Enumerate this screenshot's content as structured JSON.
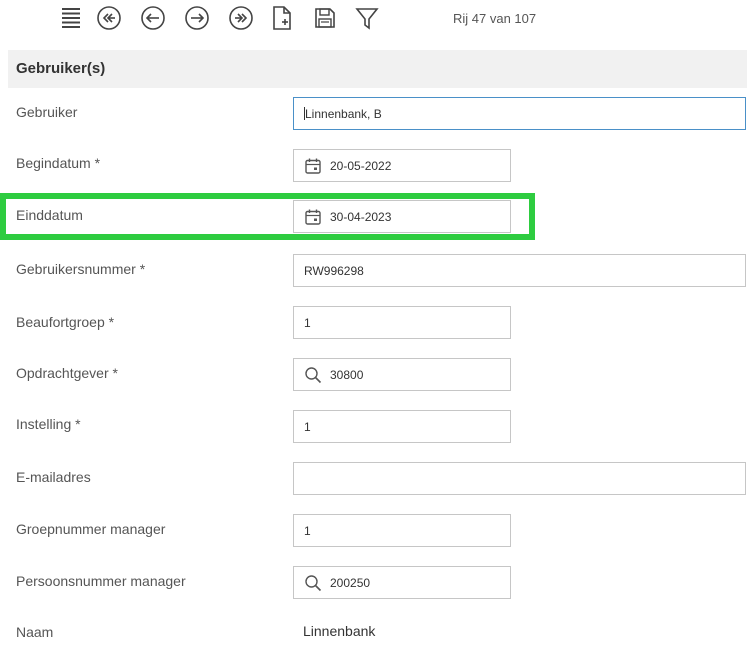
{
  "toolbar": {
    "row_counter": "Rij 47 van 107",
    "buttons": [
      {
        "name": "list-icon"
      },
      {
        "name": "first-record-icon"
      },
      {
        "name": "previous-record-icon"
      },
      {
        "name": "next-record-icon"
      },
      {
        "name": "last-record-icon"
      },
      {
        "name": "new-document-icon"
      },
      {
        "name": "save-icon"
      },
      {
        "name": "filter-icon"
      }
    ]
  },
  "section": {
    "title": "Gebruiker(s)"
  },
  "fields": {
    "gebruiker": {
      "label": "Gebruiker",
      "value": "Linnenbank, B"
    },
    "begindatum": {
      "label": "Begindatum *",
      "value": "20-05-2022",
      "icon": "calendar-icon"
    },
    "einddatum": {
      "label": "Einddatum",
      "value": "30-04-2023",
      "icon": "calendar-icon"
    },
    "gebruikersnummer": {
      "label": "Gebruikersnummer *",
      "value": "RW996298"
    },
    "beaufortgroep": {
      "label": "Beaufortgroep *",
      "value": "1"
    },
    "opdrachtgever": {
      "label": "Opdrachtgever *",
      "value": "30800",
      "icon": "search-icon"
    },
    "instelling": {
      "label": "Instelling *",
      "value": "1"
    },
    "emailadres": {
      "label": "E-mailadres",
      "value": ""
    },
    "groepnummer_manager": {
      "label": "Groepnummer manager",
      "value": "1"
    },
    "persoonsnummer_manager": {
      "label": "Persoonsnummer manager",
      "value": "200250",
      "icon": "search-icon"
    },
    "naam": {
      "label": "Naam",
      "value": "Linnenbank"
    }
  },
  "colors": {
    "highlight": "#2ecc40",
    "focus_border": "#4a90c8",
    "header_bg": "#f1f1f1"
  }
}
